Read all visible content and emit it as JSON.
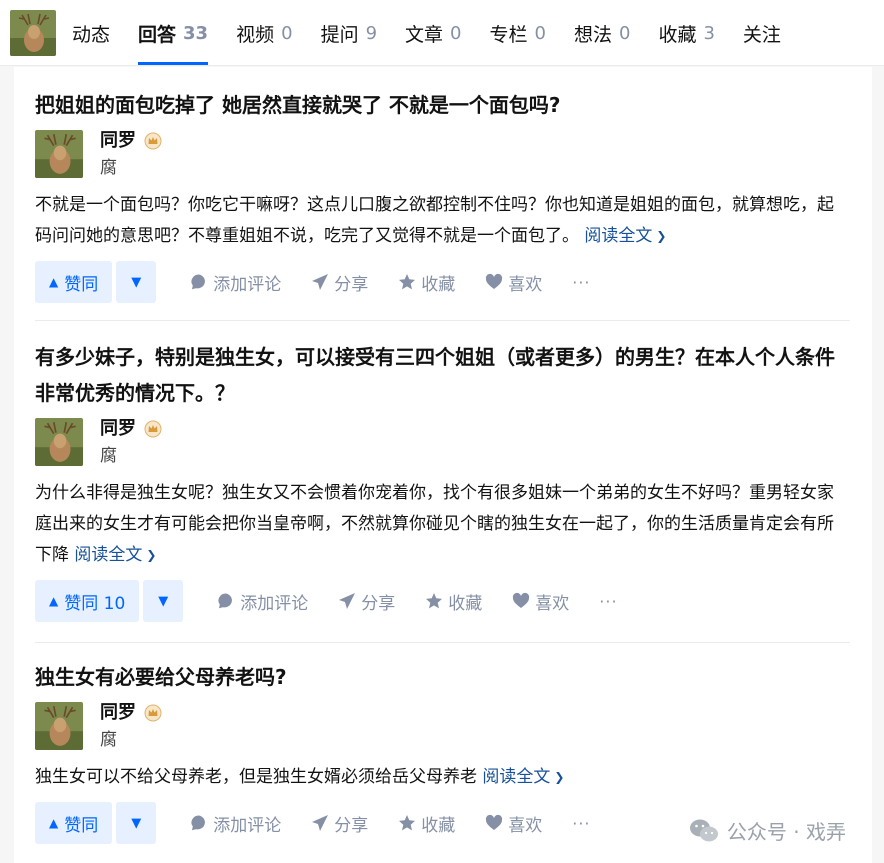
{
  "tabs": [
    {
      "label": "动态",
      "count": ""
    },
    {
      "label": "回答",
      "count": "33"
    },
    {
      "label": "视频",
      "count": "0"
    },
    {
      "label": "提问",
      "count": "9"
    },
    {
      "label": "文章",
      "count": "0"
    },
    {
      "label": "专栏",
      "count": "0"
    },
    {
      "label": "想法",
      "count": "0"
    },
    {
      "label": "收藏",
      "count": "3"
    },
    {
      "label": "关注",
      "count": ""
    }
  ],
  "answers": [
    {
      "title": "把姐姐的面包吃掉了 她居然直接就哭了 不就是一个面包吗?",
      "author": "同罗",
      "bio": "腐",
      "excerpt": "不就是一个面包吗？你吃它干嘛呀？这点儿口腹之欲都控制不住吗？你也知道是姐姐的面包，就算想吃，起码问问她的意思吧？不尊重姐姐不说，吃完了又觉得不就是一个面包了。",
      "read_more": "阅读全文",
      "vote_label": "赞同"
    },
    {
      "title": "有多少妹子，特别是独生女，可以接受有三四个姐姐（或者更多）的男生？在本人个人条件非常优秀的情况下。？",
      "author": "同罗",
      "bio": "腐",
      "excerpt": "为什么非得是独生女呢？独生女又不会惯着你宠着你，找个有很多姐妹一个弟弟的女生不好吗？重男轻女家庭出来的女生才有可能会把你当皇帝啊，不然就算你碰见个瞎的独生女在一起了，你的生活质量肯定会有所下降",
      "read_more": "阅读全文",
      "vote_label": "赞同 10"
    },
    {
      "title": "独生女有必要给父母养老吗?",
      "author": "同罗",
      "bio": "腐",
      "excerpt": "独生女可以不给父母养老，但是独生女婿必须给岳父母养老",
      "read_more": "阅读全文",
      "vote_label": "赞同"
    }
  ],
  "actions": {
    "comment": "添加评论",
    "share": "分享",
    "favorite": "收藏",
    "like": "喜欢",
    "more": "···"
  },
  "watermark": "公众号 · 戏弄",
  "colors": {
    "accent": "#0066ff",
    "accent_bg": "#e6f0ff",
    "muted": "#8590a6",
    "link": "#175199"
  },
  "icons": [
    "deer-avatar",
    "crown-badge-icon",
    "caret-up-icon",
    "caret-down-icon",
    "comment-icon",
    "share-icon",
    "star-icon",
    "heart-icon",
    "more-icon",
    "wechat-icon"
  ]
}
